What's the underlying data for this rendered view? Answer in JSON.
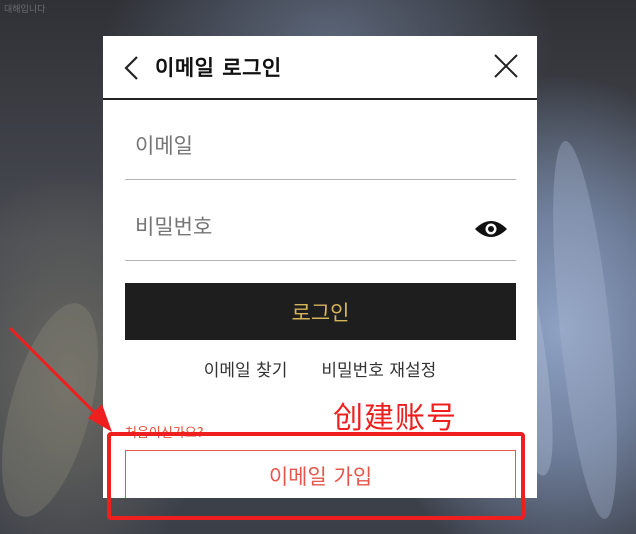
{
  "background": {
    "corner_text": "대해입니다"
  },
  "dialog": {
    "title": "이메일 로그인",
    "back_icon": "chevron-left-icon",
    "close_icon": "close-x-icon"
  },
  "form": {
    "email_placeholder": "이메일",
    "password_placeholder": "비밀번호",
    "password_toggle_icon": "eye-icon",
    "login_label": "로그인"
  },
  "links": {
    "find_email": "이메일 찾기",
    "reset_password": "비밀번호 재설정"
  },
  "signup": {
    "prompt": "처음이신가요?",
    "button_label": "이메일 가입"
  },
  "annotation": {
    "label": "创建账号",
    "color": "#ef1f1f"
  },
  "colors": {
    "login_bg": "#1e1e1e",
    "login_text": "#d5b45a",
    "signup_accent": "#e4574a"
  }
}
